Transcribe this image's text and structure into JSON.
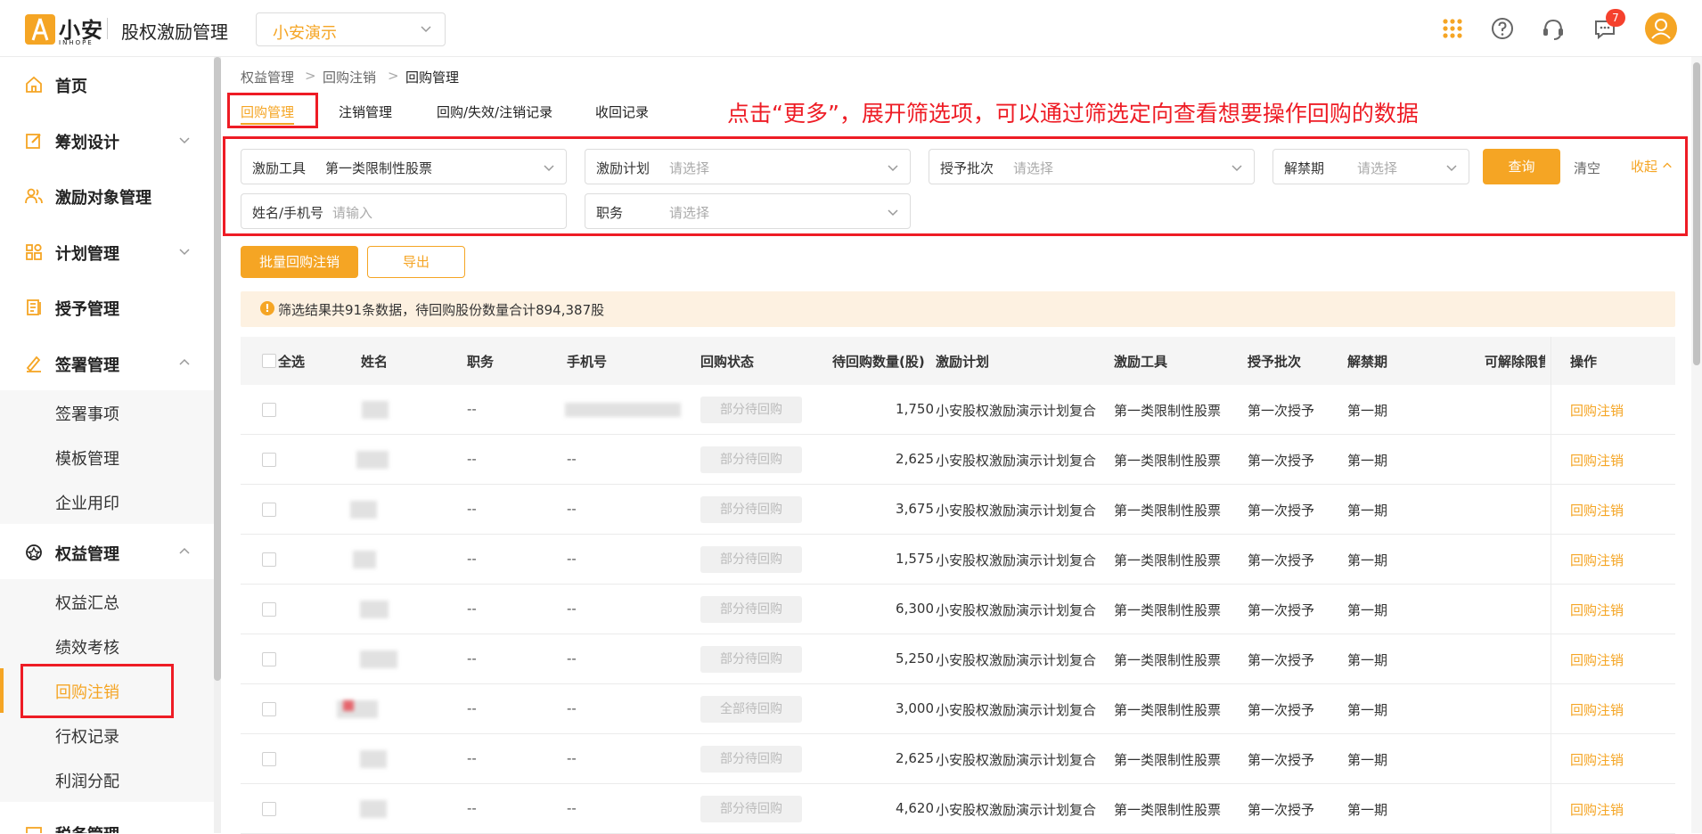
{
  "header": {
    "logo_text": "小安",
    "logo_sub": "INHOPE",
    "app_title": "股权激励管理",
    "company": "小安演示",
    "message_count": "7"
  },
  "sidebar": {
    "items": [
      {
        "label": "首页",
        "icon": "home-icon"
      },
      {
        "label": "筹划设计",
        "icon": "edit-icon"
      },
      {
        "label": "激励对象管理",
        "icon": "users-icon"
      },
      {
        "label": "计划管理",
        "icon": "grid-icon"
      },
      {
        "label": "授予管理",
        "icon": "document-icon"
      },
      {
        "label": "签署管理",
        "icon": "pen-icon"
      },
      {
        "label": "权益管理",
        "icon": "equity-icon"
      },
      {
        "label": "税务管理",
        "icon": "tax-icon"
      }
    ],
    "sign_sub": [
      "签署事项",
      "模板管理",
      "企业用印"
    ],
    "equity_sub": [
      "权益汇总",
      "绩效考核",
      "回购注销",
      "行权记录",
      "利润分配"
    ]
  },
  "breadcrumb": [
    "权益管理",
    "回购注销",
    "回购管理"
  ],
  "tabs": [
    "回购管理",
    "注销管理",
    "回购/失效/注销记录",
    "收回记录"
  ],
  "annotation": "点击“更多”，展开筛选项，可以通过筛选定向查看想要操作回购的数据",
  "filters": {
    "tool_label": "激励工具",
    "tool_value": "第一类限制性股票",
    "plan_label": "激励计划",
    "plan_placeholder": "请选择",
    "batch_label": "授予批次",
    "batch_placeholder": "请选择",
    "period_label": "解禁期",
    "period_placeholder": "请选择",
    "name_label": "姓名/手机号",
    "name_placeholder": "请输入",
    "position_label": "职务",
    "position_placeholder": "请选择",
    "query": "查询",
    "clear": "清空",
    "collapse": "收起"
  },
  "actions": {
    "batch": "批量回购注销",
    "export": "导出"
  },
  "notice": "筛选结果共91条数据，待回购股份数量合计894,387股",
  "table": {
    "headers": [
      "全选",
      "姓名",
      "职务",
      "手机号",
      "回购状态",
      "待回购数量(股)",
      "激励计划",
      "激励工具",
      "授予批次",
      "解禁期",
      "可解除限售",
      "操作"
    ],
    "rows": [
      {
        "position": "--",
        "phone": "",
        "status": "部分待回购",
        "qty": "1,750",
        "plan": "小安股权激励演示计划复合",
        "tool": "第一类限制性股票",
        "batch": "第一次授予",
        "period": "第一期",
        "op": "回购注销"
      },
      {
        "position": "--",
        "phone": "--",
        "status": "部分待回购",
        "qty": "2,625",
        "plan": "小安股权激励演示计划复合",
        "tool": "第一类限制性股票",
        "batch": "第一次授予",
        "period": "第一期",
        "op": "回购注销"
      },
      {
        "position": "--",
        "phone": "--",
        "status": "部分待回购",
        "qty": "3,675",
        "plan": "小安股权激励演示计划复合",
        "tool": "第一类限制性股票",
        "batch": "第一次授予",
        "period": "第一期",
        "op": "回购注销"
      },
      {
        "position": "--",
        "phone": "--",
        "status": "部分待回购",
        "qty": "1,575",
        "plan": "小安股权激励演示计划复合",
        "tool": "第一类限制性股票",
        "batch": "第一次授予",
        "period": "第一期",
        "op": "回购注销"
      },
      {
        "position": "--",
        "phone": "--",
        "status": "部分待回购",
        "qty": "6,300",
        "plan": "小安股权激励演示计划复合",
        "tool": "第一类限制性股票",
        "batch": "第一次授予",
        "period": "第一期",
        "op": "回购注销"
      },
      {
        "position": "--",
        "phone": "--",
        "status": "部分待回购",
        "qty": "5,250",
        "plan": "小安股权激励演示计划复合",
        "tool": "第一类限制性股票",
        "batch": "第一次授予",
        "period": "第一期",
        "op": "回购注销"
      },
      {
        "position": "--",
        "phone": "--",
        "status": "全部待回购",
        "qty": "3,000",
        "plan": "小安股权激励演示计划复合",
        "tool": "第一类限制性股票",
        "batch": "第一次授予",
        "period": "第一期",
        "op": "回购注销"
      },
      {
        "position": "--",
        "phone": "--",
        "status": "部分待回购",
        "qty": "2,625",
        "plan": "小安股权激励演示计划复合",
        "tool": "第一类限制性股票",
        "batch": "第一次授予",
        "period": "第一期",
        "op": "回购注销"
      },
      {
        "position": "--",
        "phone": "--",
        "status": "部分待回购",
        "qty": "4,620",
        "plan": "小安股权激励演示计划复合",
        "tool": "第一类限制性股票",
        "batch": "第一次授予",
        "period": "第一期",
        "op": "回购注销"
      }
    ]
  }
}
